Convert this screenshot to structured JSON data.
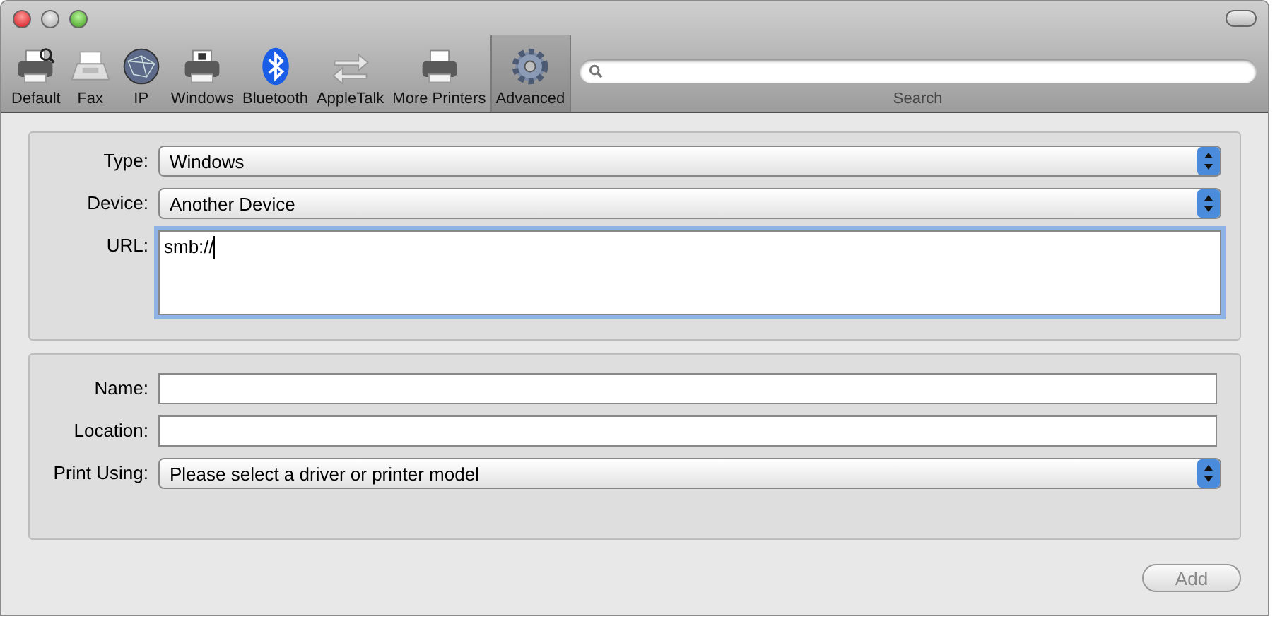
{
  "toolbar": {
    "items": [
      {
        "kind": "default",
        "label": "Default",
        "selected": false
      },
      {
        "kind": "fax",
        "label": "Fax",
        "selected": false
      },
      {
        "kind": "ip",
        "label": "IP",
        "selected": false
      },
      {
        "kind": "windows",
        "label": "Windows",
        "selected": false
      },
      {
        "kind": "bluetooth",
        "label": "Bluetooth",
        "selected": false
      },
      {
        "kind": "appletalk",
        "label": "AppleTalk",
        "selected": false
      },
      {
        "kind": "more",
        "label": "More Printers",
        "selected": false
      },
      {
        "kind": "advanced",
        "label": "Advanced",
        "selected": true
      }
    ],
    "search": {
      "label": "Search"
    }
  },
  "connection": [
    {
      "kind": "select",
      "label": "Type:",
      "value": "Windows"
    },
    {
      "kind": "select",
      "label": "Device:",
      "value": "Another Device"
    },
    {
      "kind": "textarea",
      "label": "URL:",
      "value": "smb://",
      "focused": true
    }
  ],
  "printer": [
    {
      "kind": "text",
      "label": "Name:"
    },
    {
      "kind": "text",
      "label": "Location:"
    },
    {
      "kind": "select",
      "label": "Print Using:",
      "value": "Please select a driver or printer model"
    }
  ],
  "add_button": {
    "label": "Add",
    "disabled": true
  }
}
